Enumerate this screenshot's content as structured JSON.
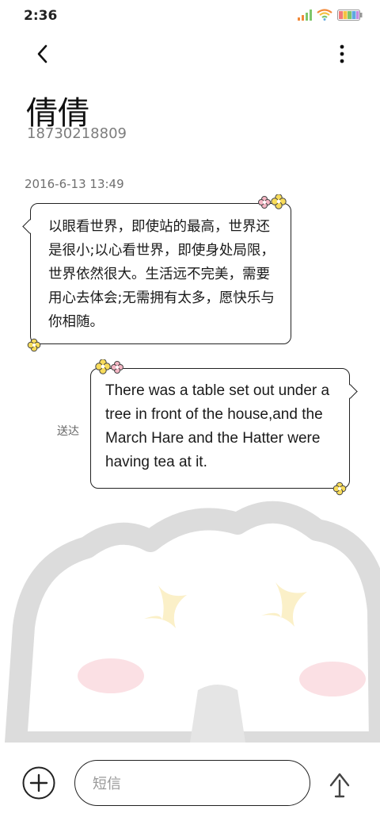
{
  "status_bar": {
    "time": "2:36"
  },
  "header": {
    "back_icon": "chevron-left-icon",
    "more_icon": "more-vertical-icon"
  },
  "contact": {
    "name": "倩倩",
    "number": "18730218809"
  },
  "conversation": {
    "timestamp": "2016-6-13 13:49",
    "messages": [
      {
        "direction": "incoming",
        "text": "以眼看世界，即使站的最高，世界还是很小;以心看世界，即使身处局限，世界依然很大。生活远不完美，需要用心去体会;无需拥有太多，愿快乐与你相随。"
      },
      {
        "direction": "outgoing",
        "text": "There was a table set out under a tree in front of the house,and the March Hare and the Hatter were having tea at it.",
        "status": "送达"
      }
    ]
  },
  "compose": {
    "placeholder": "短信",
    "add_icon": "plus-circle-icon",
    "send_icon": "arrow-up-icon"
  },
  "colors": {
    "bubble_border": "#222222",
    "flower_yellow": "#f8dc5a",
    "flower_pink": "#f5b6c4",
    "background_art": "#d9d9d9"
  }
}
